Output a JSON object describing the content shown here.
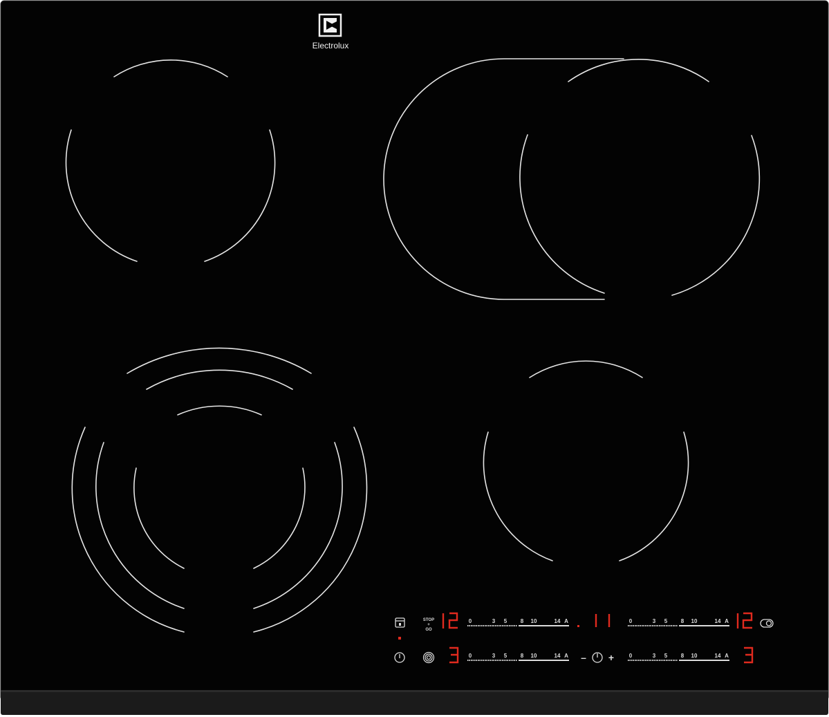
{
  "brand": {
    "name": "Electrolux",
    "logo_icon": "electrolux-logo-icon"
  },
  "colors": {
    "glass": "#030303",
    "ring": "#e6e6e6",
    "display_red": "#e02a1e",
    "scale_white": "#dcdcdc",
    "frame": "#1a1a1a"
  },
  "controls": {
    "lock_icon": "lock-icon",
    "stop_go": {
      "line1": "STOP",
      "line2": "+",
      "line3": "GO"
    },
    "power_icon": "power-icon",
    "bridge_icon": "bridge-zone-icon",
    "oval_icon": "oval-zone-icon",
    "timer": {
      "minus": "–",
      "plus": "+",
      "icon": "timer-icon",
      "display": ". 1 1"
    },
    "zones": [
      {
        "display": "12",
        "scale": [
          "0",
          "3",
          "5",
          "8",
          "10",
          "14",
          "A"
        ]
      },
      {
        "display": "12",
        "scale": [
          "0",
          "3",
          "5",
          "8",
          "10",
          "14",
          "A"
        ]
      },
      {
        "display": "3",
        "scale": [
          "0",
          "3",
          "5",
          "8",
          "10",
          "14",
          "A"
        ]
      },
      {
        "display": "3",
        "scale": [
          "0",
          "3",
          "5",
          "8",
          "10",
          "14",
          "A"
        ]
      }
    ]
  }
}
